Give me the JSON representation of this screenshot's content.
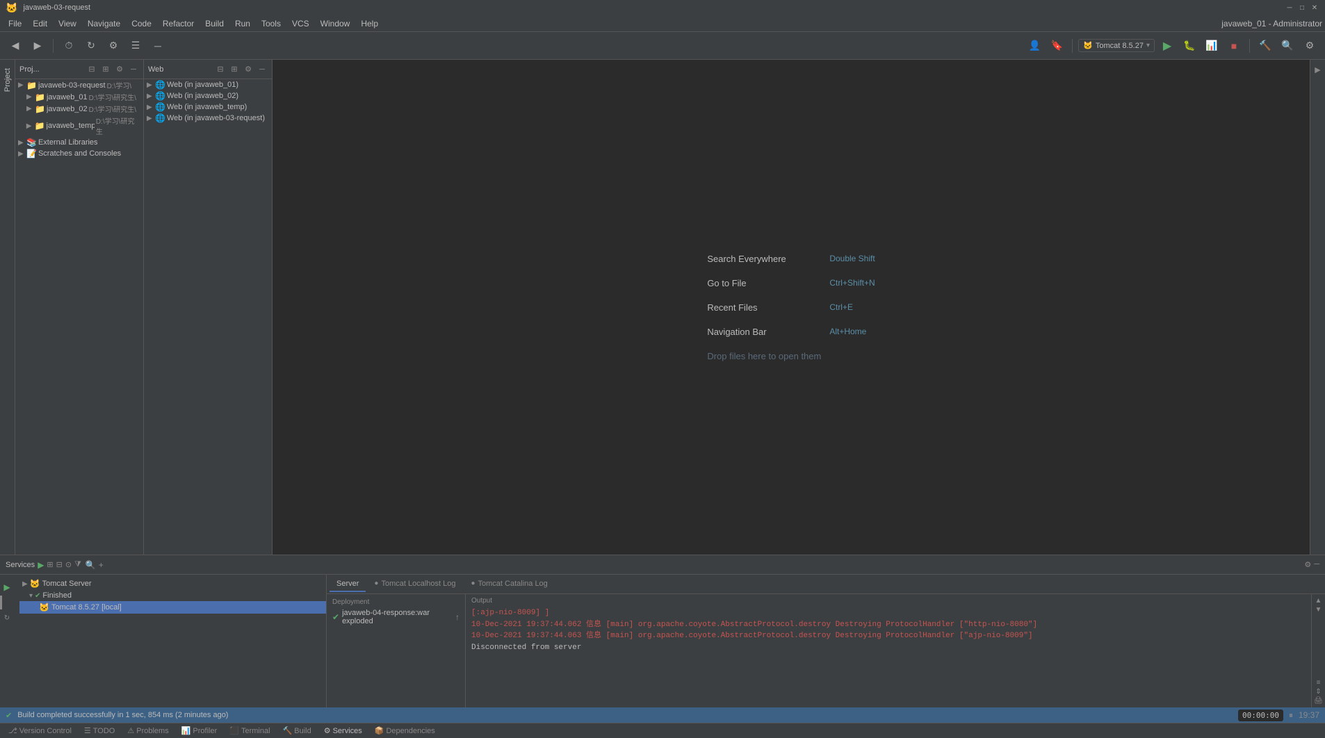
{
  "titlebar": {
    "title": "javaweb-03-request",
    "app_title": "javaweb_01 - Administrator",
    "min": "─",
    "max": "□",
    "close": "✕"
  },
  "menubar": {
    "items": [
      "File",
      "Edit",
      "View",
      "Navigate",
      "Code",
      "Refactor",
      "Build",
      "Run",
      "Tools",
      "VCS",
      "Window",
      "Help"
    ],
    "app_name": "javaweb_01 - Administrator"
  },
  "toolbar": {
    "run_config": "Tomcat 8.5.27",
    "run_dropdown": "▾"
  },
  "project_panel": {
    "title": "Proj...",
    "items": [
      {
        "label": "javaweb-03-request",
        "sublabel": "D:\\学习\\",
        "indent": 0,
        "arrow": "▶",
        "icon": "📁"
      },
      {
        "label": "javaweb_01",
        "sublabel": "D:\\学习\\研究生\\",
        "indent": 1,
        "arrow": "▶",
        "icon": "📁"
      },
      {
        "label": "javaweb_02",
        "sublabel": "D:\\学习\\研究生\\",
        "indent": 1,
        "arrow": "▶",
        "icon": "📁"
      },
      {
        "label": "javaweb_temp",
        "sublabel": "D:\\学习\\研究生",
        "indent": 1,
        "arrow": "▶",
        "icon": "📁"
      },
      {
        "label": "External Libraries",
        "sublabel": "",
        "indent": 0,
        "arrow": "▶",
        "icon": "📚"
      },
      {
        "label": "Scratches and Consoles",
        "sublabel": "",
        "indent": 0,
        "arrow": "▶",
        "icon": "📝"
      }
    ]
  },
  "web_panel": {
    "title": "Web",
    "items": [
      {
        "label": "Web (in javaweb_01)",
        "indent": 0
      },
      {
        "label": "Web (in javaweb_02)",
        "indent": 0
      },
      {
        "label": "Web (in javaweb_temp)",
        "indent": 0
      },
      {
        "label": "Web (in javaweb-03-request)",
        "indent": 0
      }
    ]
  },
  "editor": {
    "hints": [
      {
        "name": "Search Everywhere",
        "key": "Double Shift"
      },
      {
        "name": "Go to File",
        "key": "Ctrl+Shift+N"
      },
      {
        "name": "Recent Files",
        "key": "Ctrl+E"
      },
      {
        "name": "Navigation Bar",
        "key": "Alt+Home"
      }
    ],
    "drop_hint": "Drop files here to open them"
  },
  "services_panel": {
    "title": "Services",
    "toolbar": {
      "run": "▶",
      "expand_all": "⊞",
      "collapse_all": "⊟",
      "group": "⊙",
      "filter": "⧩",
      "add": "+"
    },
    "tree": {
      "items": [
        {
          "label": "Tomcat Server",
          "indent": 0,
          "icon": "🐱",
          "arrow": "▶"
        },
        {
          "label": "Finished",
          "indent": 1,
          "icon": "✅",
          "arrow": "▾"
        },
        {
          "label": "Tomcat 8.5.27 [local]",
          "indent": 2,
          "icon": "🐱"
        }
      ]
    },
    "tabs": [
      "Server",
      "Tomcat Localhost Log",
      "Tomcat Catalina Log"
    ],
    "active_tab": "Server",
    "deployment": {
      "title": "Deployment",
      "items": [
        {
          "label": "javaweb-04-response:war exploded",
          "deployed": true
        }
      ]
    },
    "output": {
      "title": "Output",
      "lines": [
        {
          "text": "[:ajp-nio-8009] ]",
          "type": "red"
        },
        {
          "text": "10-Dec-2021 19:37:44.062 信息 [main] org.apache.coyote.AbstractProtocol.destroy Destroying ProtocolHandler [\"http-nio-8080\"]",
          "type": "red"
        },
        {
          "text": "10-Dec-2021 19:37:44.063 信息 [main] org.apache.coyote.AbstractProtocol.destroy Destroying ProtocolHandler [\"ajp-nio-8009\"]",
          "type": "red"
        },
        {
          "text": "Disconnected from server",
          "type": "white"
        }
      ]
    }
  },
  "taskbar": {
    "items": [
      {
        "label": "Version Control",
        "icon": "⎇"
      },
      {
        "label": "TODO",
        "icon": "☰"
      },
      {
        "label": "Problems",
        "icon": "⚠"
      },
      {
        "label": "Profiler",
        "icon": "📊"
      },
      {
        "label": "Terminal",
        "icon": "⬛"
      },
      {
        "label": "Build",
        "icon": "🔨"
      },
      {
        "label": "Services",
        "icon": "⚙",
        "active": true
      },
      {
        "label": "Dependencies",
        "icon": "📦"
      }
    ]
  },
  "status_bar": {
    "message": "Build completed successfully in 1 sec, 854 ms (2 minutes ago)",
    "timer": "00:00:00",
    "time": "19:37"
  },
  "colors": {
    "accent": "#4b6eaf",
    "bg_main": "#2b2b2b",
    "bg_panel": "#3c3f41",
    "text_primary": "#bbbbbb",
    "text_secondary": "#888888",
    "green": "#59a869",
    "red": "#c75450",
    "status_bar_bg": "#3d6185"
  }
}
